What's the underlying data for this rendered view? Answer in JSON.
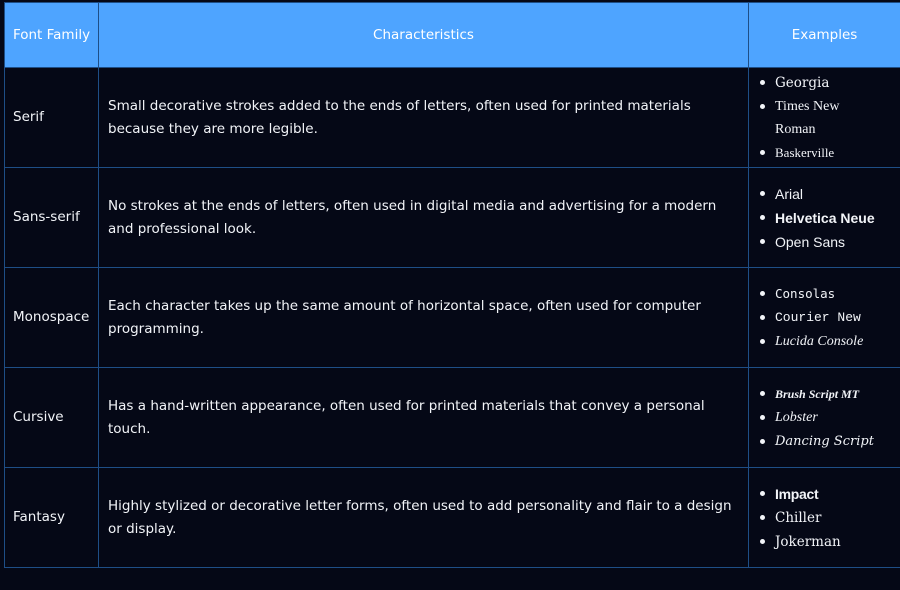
{
  "headers": {
    "family": "Font Family",
    "characteristics": "Characteristics",
    "examples": "Examples"
  },
  "rows": [
    {
      "family": "Serif",
      "description": "Small decorative strokes added to the ends of letters, often used for printed materials because they are more legible.",
      "examples": [
        "Georgia",
        "Times New Roman",
        "Baskerville"
      ]
    },
    {
      "family": "Sans-serif",
      "description": "No strokes at the ends of letters, often used in digital media and advertising for a modern and professional look.",
      "examples": [
        "Arial",
        "Helvetica Neue",
        "Open Sans"
      ]
    },
    {
      "family": "Monospace",
      "description": "Each character takes up the same amount of horizontal space, often used for computer programming.",
      "examples": [
        "Consolas",
        "Courier New",
        "Lucida Console"
      ]
    },
    {
      "family": "Cursive",
      "description": "Has a hand-written appearance, often used for printed materials that convey a personal touch.",
      "examples": [
        "Brush Script MT",
        "Lobster",
        "Dancing Script"
      ]
    },
    {
      "family": "Fantasy",
      "description": "Highly stylized or decorative letter forms, often used to add personality and flair to a design or display.",
      "examples": [
        "Impact",
        "Chiller",
        "Jokerman"
      ]
    }
  ],
  "colors": {
    "header_bg": "#4ea4ff",
    "body_bg": "#050816",
    "border": "#1e4e86",
    "text": "#f2f4f8"
  }
}
